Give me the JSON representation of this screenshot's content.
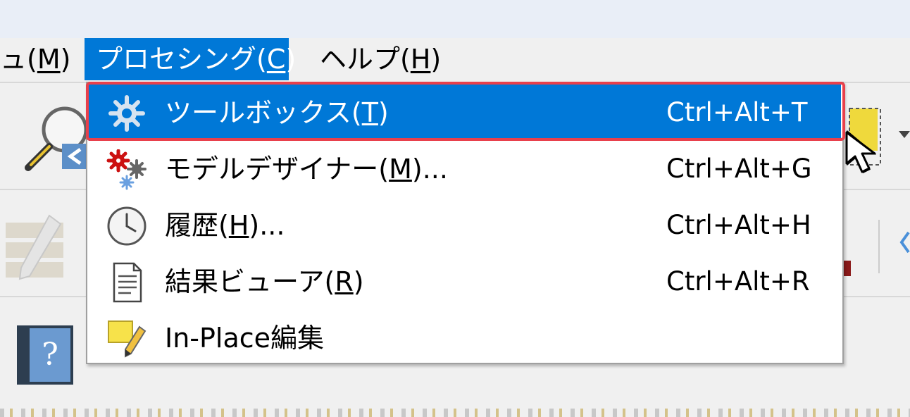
{
  "menubar": {
    "items": [
      {
        "prefix": "ュ(",
        "key": "M",
        "suffix": ")"
      },
      {
        "prefix": "プロセシング(",
        "key": "C",
        "suffix": ")"
      },
      {
        "prefix": "ヘルプ(",
        "key": "H",
        "suffix": ")"
      }
    ]
  },
  "dropdown": {
    "items": [
      {
        "label_prefix": "ツールボックス(",
        "key": "T",
        "label_suffix": ")",
        "shortcut": "Ctrl+Alt+T",
        "icon": "gear-icon",
        "selected": true
      },
      {
        "label_prefix": "モデルデザイナー(",
        "key": "M",
        "label_suffix": ")...",
        "shortcut": "Ctrl+Alt+G",
        "icon": "model-designer-gears-icon",
        "selected": false
      },
      {
        "label_prefix": "履歴(",
        "key": "H",
        "label_suffix": ")...",
        "shortcut": "Ctrl+Alt+H",
        "icon": "clock-icon",
        "selected": false
      },
      {
        "label_prefix": "結果ビューア(",
        "key": "R",
        "label_suffix": ")",
        "shortcut": "Ctrl+Alt+R",
        "icon": "document-icon",
        "selected": false
      },
      {
        "label_prefix": "In-Place編集",
        "key": "",
        "label_suffix": "",
        "shortcut": "",
        "icon": "in-place-edit-icon",
        "selected": false
      }
    ]
  },
  "toolbar": {
    "help_icon_text": "?"
  },
  "colors": {
    "accent": "#0078d7",
    "highlight_border": "#e8404c"
  }
}
